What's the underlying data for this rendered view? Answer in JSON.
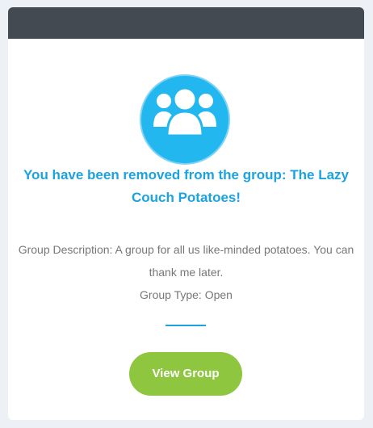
{
  "notification": {
    "icon": "group-icon",
    "title": "You have been removed from the group: The Lazy Couch Potatoes!",
    "description": "Group Description: A group for all us like-minded potatoes. You can thank me later.",
    "group_type": "Group Type: Open",
    "button_label": "View Group"
  },
  "colors": {
    "header": "#434a52",
    "accent": "#1ba3e0",
    "icon_bg": "#22b8ef",
    "button": "#8ec640",
    "background": "#edf0f4"
  }
}
